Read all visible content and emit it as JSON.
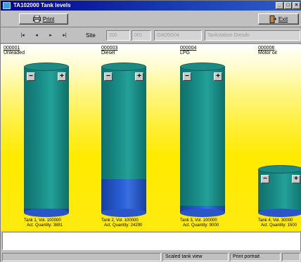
{
  "window": {
    "title": "TA102000 Tank levels",
    "controls": [
      "_",
      "□",
      "×"
    ]
  },
  "toolbar": {
    "print_label": "Print",
    "exit_label": "Exit"
  },
  "navigation": {
    "buttons": [
      "|◂",
      "◂",
      "▸",
      "▸|"
    ],
    "site_label": "Site",
    "fields": [
      "200",
      "001",
      "OAD5D04",
      "Tankstation Dresdn"
    ]
  },
  "tanks": [
    {
      "id": "000001",
      "product": "Unleaded",
      "label": "Tank 1, Vol. 100000",
      "quantity_text": "Act. Quantity: 3881",
      "fill_fraction": 0.03
    },
    {
      "id": "000003",
      "product": "Diesel",
      "label": "Tank 2, Vol. 100000",
      "quantity_text": "Act. Quantity: 24290",
      "fill_fraction": 0.24
    },
    {
      "id": "000004",
      "product": "LPG",
      "label": "Tank 3, Vol. 100000",
      "quantity_text": "Act. Quantity: 9000",
      "fill_fraction": 0.05
    },
    {
      "id": "000006",
      "product": "Motor oil",
      "label": "Tank 4, Vol. 30000",
      "quantity_text": "Act. Quantity: 1500",
      "fill_fraction": 0.05
    }
  ],
  "tank_controls": {
    "minus": "−",
    "plus": "+"
  },
  "status": {
    "message": "",
    "cells": [
      "",
      "Scaled tank view",
      "Print portrait",
      ""
    ]
  },
  "colors": {
    "tank_body": "#1a8f88",
    "tank_fill": "#2a5fd8",
    "background_yellow": "#ffea00",
    "title_bar": "#00008a"
  }
}
